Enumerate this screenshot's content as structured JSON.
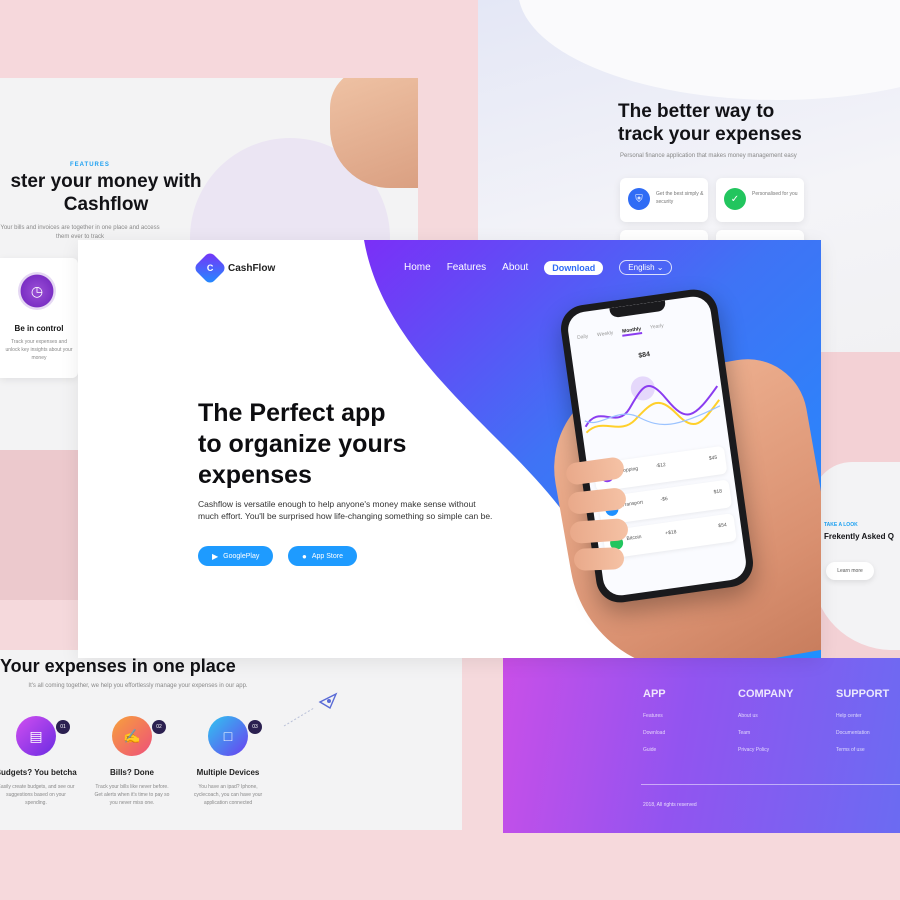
{
  "features_panel": {
    "eyebrow": "FEATURES",
    "title": "ster your money with Cashflow",
    "description": "Your bills and invoices are together in one place and access them ever to track",
    "card": {
      "icon": "clock-icon",
      "title": "Be in control",
      "description": "Track your expenses and unlock key insights about your money"
    }
  },
  "better_panel": {
    "title_line1": "The better way to",
    "title_line2": "track your expenses",
    "description": "Personal finance application that makes money management easy",
    "cards": [
      {
        "icon": "shield-icon",
        "text": "Get the best simply & security",
        "color": "#2f6cf5"
      },
      {
        "icon": "check-icon",
        "text": "Personalised for you",
        "color": "#22c55e"
      }
    ]
  },
  "hero": {
    "logo_text": "CashFlow",
    "logo_glyph": "C",
    "nav": {
      "home": "Home",
      "features": "Features",
      "about": "About",
      "download": "Download",
      "language": "English"
    },
    "headline_line1": "The Perfect app",
    "headline_line2": "to organize yours",
    "headline_line3": "expenses",
    "subtext": "Cashflow is versatile enough to help anyone's money make sense without much effort. You'll be surprised how life-changing something so simple can be.",
    "google_play_label": "GooglePlay",
    "app_store_label": "App Store",
    "phone": {
      "tabs": [
        "Daily",
        "Weekly",
        "Monthly",
        "Yearly"
      ],
      "active_tab": "Monthly",
      "amount": "$84",
      "rows": [
        {
          "name": "Shopping",
          "amount": "-$12",
          "total": "$45",
          "color": "#8a3cf0"
        },
        {
          "name": "Transport",
          "amount": "-$6",
          "total": "$18",
          "color": "#1e90ff"
        },
        {
          "name": "Bitcoin",
          "amount": "+$18",
          "total": "$54",
          "color": "#22c55e"
        }
      ]
    }
  },
  "expenses_panel": {
    "title": "Your expenses in one place",
    "description": "It's all coming together, we help you effortlessly manage your expenses in our app.",
    "items": [
      {
        "badge": "01",
        "title": "Budgets? You betcha",
        "description": "Easily create budgets, and see our suggestions based on your spending.",
        "icon": "document-icon",
        "color": "#8a2be2"
      },
      {
        "badge": "02",
        "title": "Bills? Done",
        "description": "Track your bills like never before. Get alerts when it's time to pay so you never miss one.",
        "icon": "hand-coin-icon",
        "color": "#f5803e"
      },
      {
        "badge": "03",
        "title": "Multiple Devices",
        "description": "You have an ipad? Iphone, cyclecoach, you can have your application connected",
        "icon": "devices-icon",
        "color": "#4f7df5"
      }
    ]
  },
  "footer_panel": {
    "columns": [
      {
        "heading": "APP",
        "links": [
          "Features",
          "Download",
          "Guide"
        ]
      },
      {
        "heading": "COMPANY",
        "links": [
          "About us",
          "Team",
          "Privacy Policy"
        ]
      },
      {
        "heading": "SUPPORT",
        "links": [
          "Help center",
          "Documentation",
          "Terms of use"
        ]
      }
    ],
    "copyright": "2018, All rights reserved"
  },
  "faq_panel": {
    "eyebrow": "TAKE A LOOK",
    "title": "Frekently Asked Q",
    "button": "Learn more"
  },
  "colors": {
    "accent_blue": "#1e9bff",
    "gradient_purple": "#7b2ff7",
    "gradient_blue": "#2f6cf5",
    "footer_pink": "#c94fe8"
  }
}
